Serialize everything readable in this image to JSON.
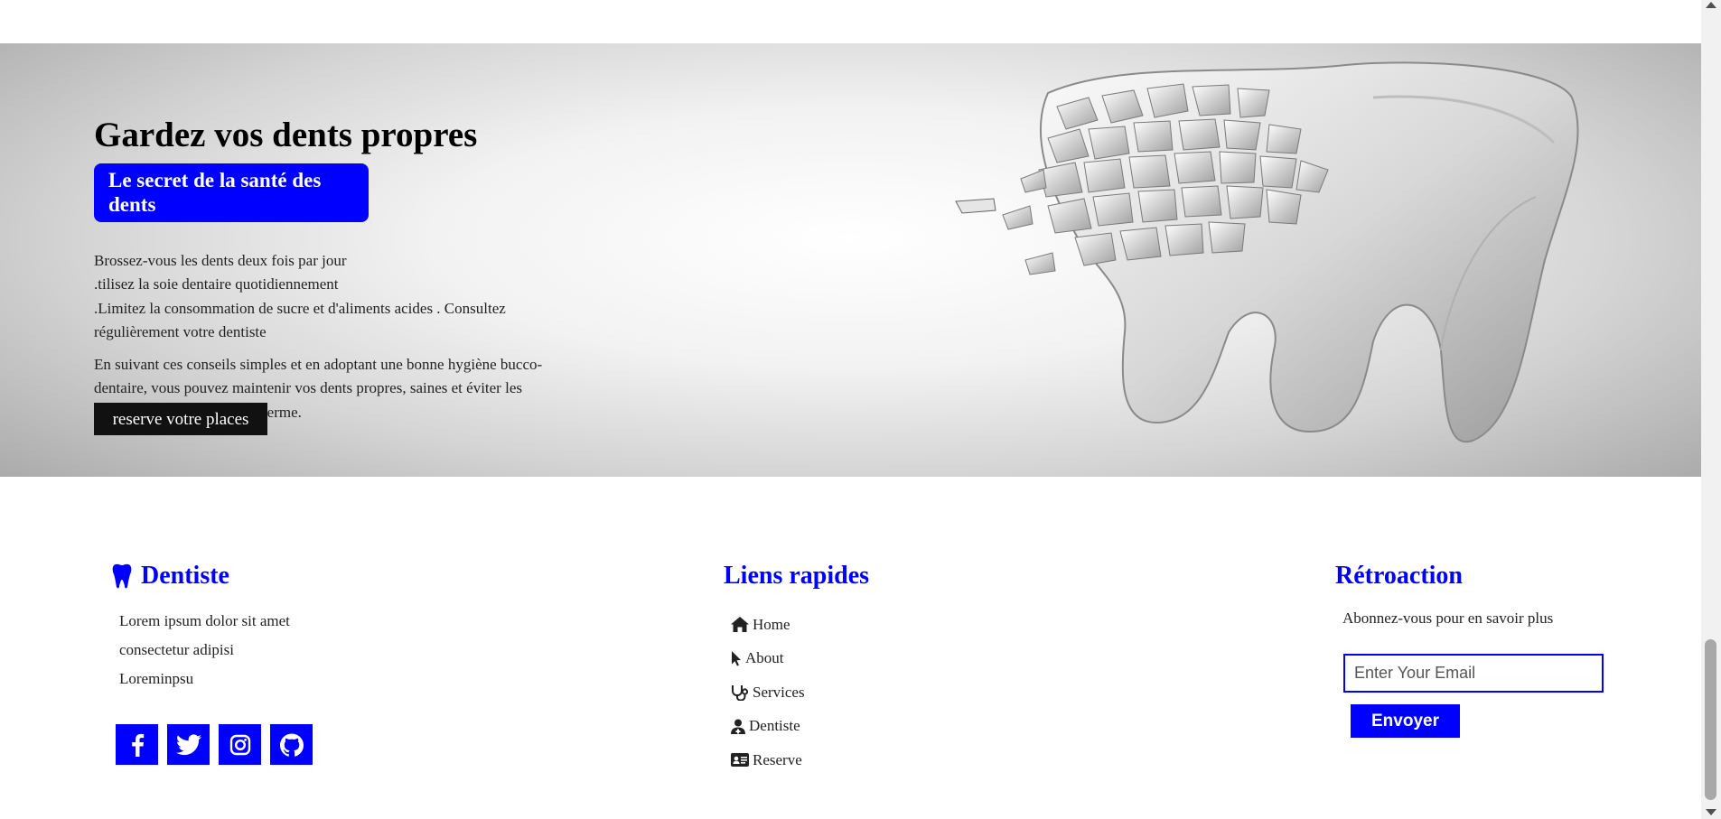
{
  "hero": {
    "title": "Gardez vos dents propres",
    "subtitle": "Le secret de la santé des dents",
    "tips": [
      "Brossez-vous les dents deux fois par jour",
      ".tilisez la soie dentaire quotidiennement",
      ".Limitez la consommation de sucre et d'aliments acides . Consultez régulièrement votre dentiste"
    ],
    "conclusion": "En suivant ces conseils simples et en adoptant une bonne hygiène bucco-dentaire, vous pouvez maintenir vos dents propres, saines et éviter les problèmes dentaires à long terme.",
    "button_label": "reserve votre places",
    "image_icon": "shattered-tooth-image"
  },
  "footer": {
    "brand": {
      "icon": "tooth-icon",
      "title": "Dentiste",
      "lines": [
        "Lorem ipsum dolor sit amet",
        "consectetur adipisi",
        "Loreminpsu"
      ],
      "socials": [
        {
          "name": "facebook-icon"
        },
        {
          "name": "twitter-icon"
        },
        {
          "name": "instagram-icon"
        },
        {
          "name": "github-icon"
        }
      ]
    },
    "quick_links": {
      "title": "Liens rapides",
      "items": [
        {
          "label": "Home",
          "icon": "home-icon"
        },
        {
          "label": "About",
          "icon": "pointer-icon"
        },
        {
          "label": "Services",
          "icon": "stethoscope-icon"
        },
        {
          "label": "Dentiste",
          "icon": "user-doctor-icon"
        },
        {
          "label": "Reserve",
          "icon": "id-card-icon"
        }
      ]
    },
    "feedback": {
      "title": "Rétroaction",
      "text": "Abonnez-vous pour en savoir plus",
      "email_placeholder": "Enter Your Email",
      "button_label": "Envoyer"
    }
  },
  "colors": {
    "accent": "#0000ff",
    "dark_button": "#111111"
  }
}
